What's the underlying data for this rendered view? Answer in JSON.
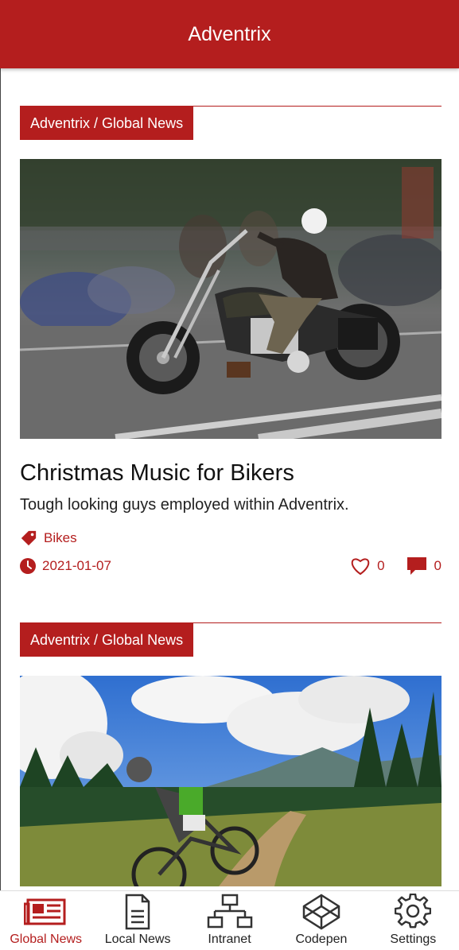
{
  "header": {
    "title": "Adventrix"
  },
  "articles": [
    {
      "breadcrumb": "Adventrix / Global News",
      "image": "motorcycle-photo",
      "title": "Christmas Music for Bikers",
      "description": "Tough looking guys employed within Adventrix.",
      "tag": "Bikes",
      "date": "2021-01-07",
      "likes": "0",
      "comments": "0"
    },
    {
      "breadcrumb": "Adventrix / Global News",
      "image": "mountain-bike-photo"
    }
  ],
  "nav": [
    {
      "label": "Global News",
      "icon": "newspaper-icon",
      "active": true
    },
    {
      "label": "Local News",
      "icon": "document-icon",
      "active": false
    },
    {
      "label": "Intranet",
      "icon": "network-icon",
      "active": false
    },
    {
      "label": "Codepen",
      "icon": "codepen-icon",
      "active": false
    },
    {
      "label": "Settings",
      "icon": "gear-icon",
      "active": false
    }
  ],
  "colors": {
    "brand": "#b41e1e",
    "background": "#ffffff",
    "text": "#111111"
  }
}
